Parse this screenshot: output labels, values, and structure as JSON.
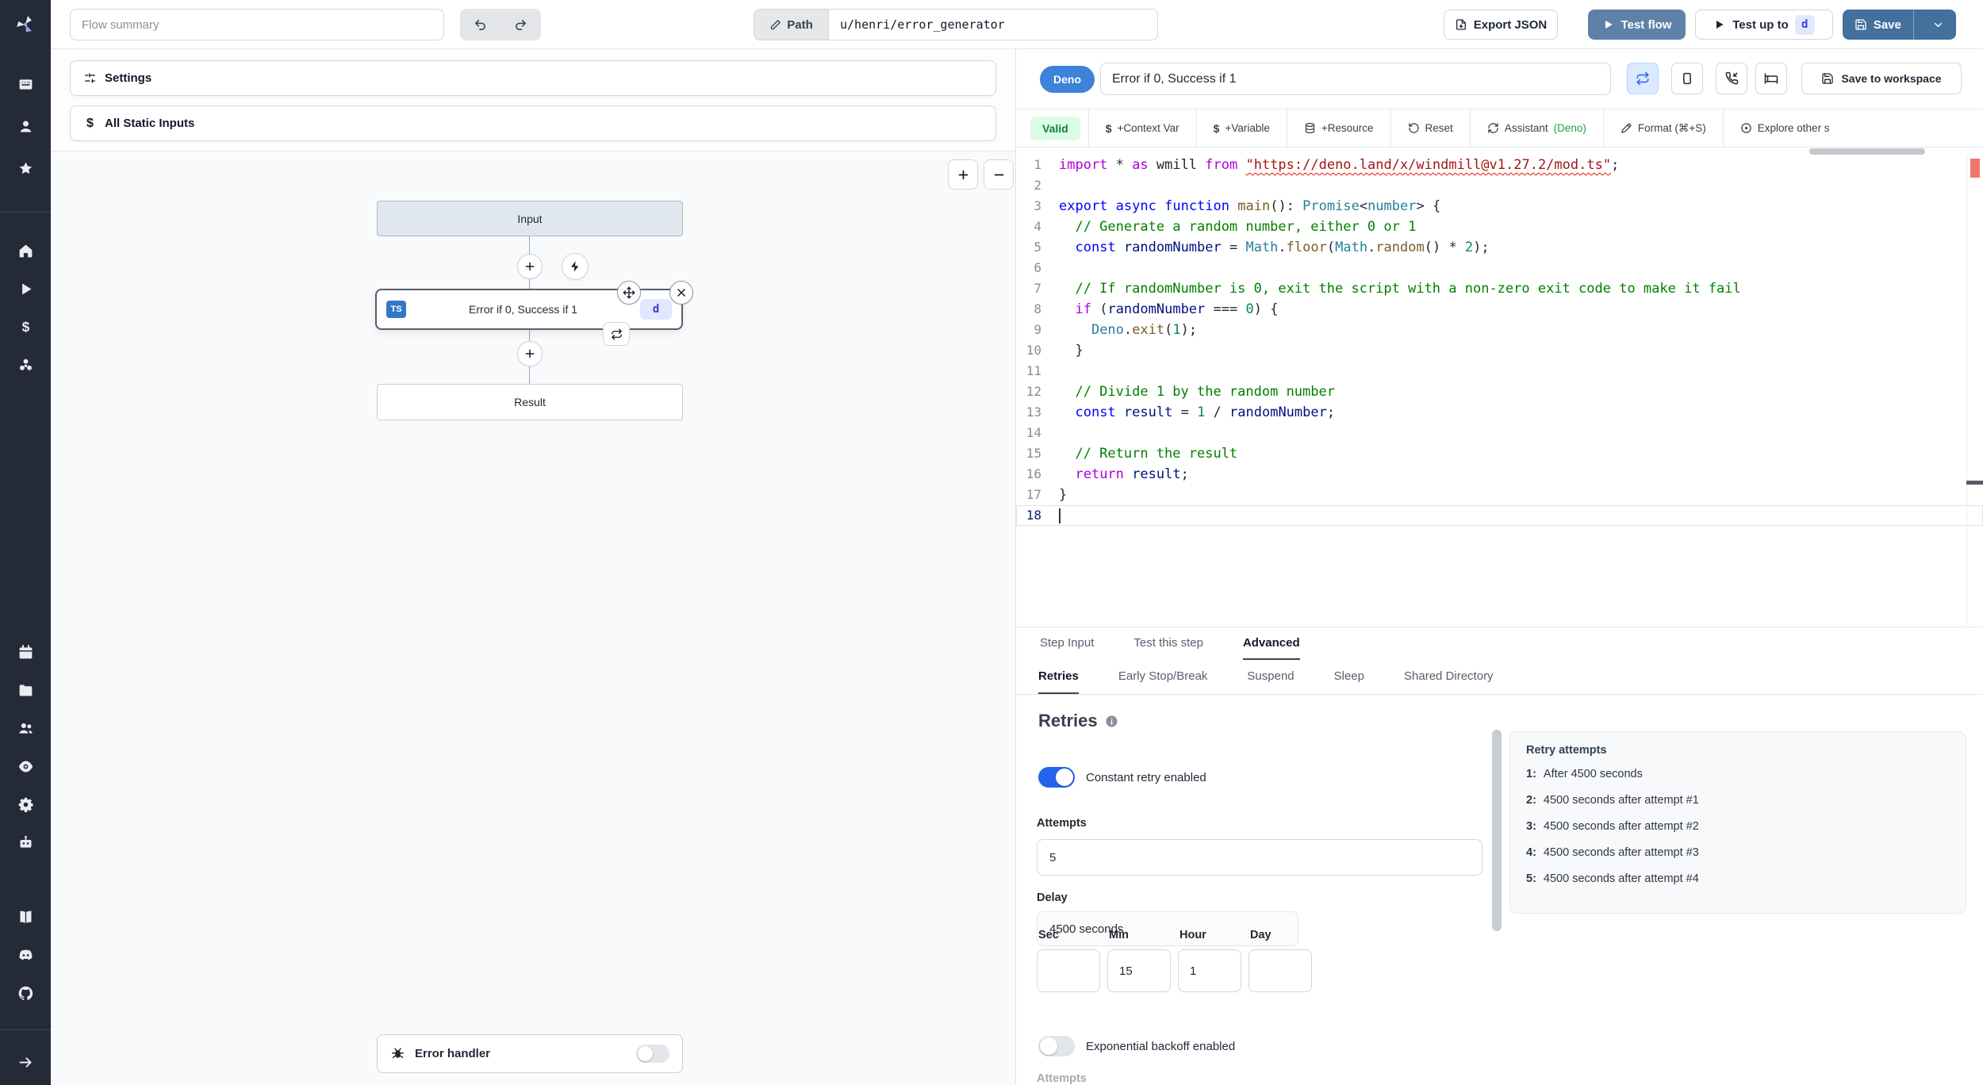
{
  "topbar": {
    "flow_summary_placeholder": "Flow summary",
    "path_label": "Path",
    "path_value": "u/henri/error_generator",
    "export_json_label": "Export JSON",
    "test_flow_label": "Test flow",
    "test_up_to_label": "Test up to",
    "test_up_to_key": "d",
    "save_label": "Save"
  },
  "sidebar": {
    "groups": [
      [
        "app-window",
        "user",
        "star"
      ],
      [
        "home",
        "play",
        "dollar",
        "resources"
      ],
      [
        "calendar",
        "folder",
        "users",
        "eye",
        "gear",
        "robot"
      ],
      [
        "book",
        "discord",
        "github"
      ],
      [
        "arrow-right"
      ]
    ]
  },
  "canvas": {
    "settings_label": "Settings",
    "all_static_inputs_label": "All Static Inputs",
    "input_node_label": "Input",
    "step_node": {
      "lang": "TS",
      "title": "Error if 0, Success if 1",
      "id_badge": "d"
    },
    "result_node_label": "Result",
    "error_handler_label": "Error handler"
  },
  "panel": {
    "header": {
      "lang_badge": "Deno",
      "step_title": "Error if 0, Success if 1",
      "save_to_workspace_label": "Save to workspace"
    },
    "toolbar": {
      "valid_label": "Valid",
      "context_var": "+Context Var",
      "variable": "+Variable",
      "resource": "+Resource",
      "reset": "Reset",
      "assistant": "Assistant",
      "assistant_lang": "(Deno)",
      "format": "Format (⌘+S)",
      "explore": "Explore other s"
    },
    "tabs": {
      "step_input": "Step Input",
      "test_this_step": "Test this step",
      "advanced": "Advanced"
    },
    "subtabs": {
      "retries": "Retries",
      "early_stop": "Early Stop/Break",
      "suspend": "Suspend",
      "sleep": "Sleep",
      "shared_directory": "Shared Directory"
    },
    "editor": {
      "lines": [
        [
          [
            "kc",
            "import"
          ],
          [
            "p",
            " * "
          ],
          [
            "kc",
            "as"
          ],
          [
            "p",
            " wmill "
          ],
          [
            "kc",
            "from"
          ],
          [
            "p",
            " "
          ],
          [
            "su",
            "\"https://deno.land/x/windmill@v1.27.2/mod.ts\""
          ],
          [
            "p",
            ";"
          ]
        ],
        [],
        [
          [
            "kb",
            "export"
          ],
          [
            "p",
            " "
          ],
          [
            "kb",
            "async"
          ],
          [
            "p",
            " "
          ],
          [
            "kb",
            "function"
          ],
          [
            "p",
            " "
          ],
          [
            "fn",
            "main"
          ],
          [
            "p",
            "(): "
          ],
          [
            "ty",
            "Promise"
          ],
          [
            "p",
            "<"
          ],
          [
            "ty",
            "number"
          ],
          [
            "p",
            "> {"
          ]
        ],
        [
          [
            "cm",
            "  // Generate a random number, either 0 or 1"
          ]
        ],
        [
          [
            "p",
            "  "
          ],
          [
            "kb",
            "const"
          ],
          [
            "p",
            " "
          ],
          [
            "id",
            "randomNumber"
          ],
          [
            "p",
            " = "
          ],
          [
            "ty",
            "Math"
          ],
          [
            "p",
            "."
          ],
          [
            "fn",
            "floor"
          ],
          [
            "p",
            "("
          ],
          [
            "ty",
            "Math"
          ],
          [
            "p",
            "."
          ],
          [
            "fn",
            "random"
          ],
          [
            "p",
            "() * "
          ],
          [
            "nu",
            "2"
          ],
          [
            "p",
            ");"
          ]
        ],
        [],
        [
          [
            "cm",
            "  // If randomNumber is 0, exit the script with a non-zero exit code to make it fail"
          ]
        ],
        [
          [
            "p",
            "  "
          ],
          [
            "kc",
            "if"
          ],
          [
            "p",
            " ("
          ],
          [
            "id",
            "randomNumber"
          ],
          [
            "p",
            " === "
          ],
          [
            "nu",
            "0"
          ],
          [
            "p",
            ") {"
          ]
        ],
        [
          [
            "p",
            "    "
          ],
          [
            "ty",
            "Deno"
          ],
          [
            "p",
            "."
          ],
          [
            "fn",
            "exit"
          ],
          [
            "p",
            "("
          ],
          [
            "nu",
            "1"
          ],
          [
            "p",
            ");"
          ]
        ],
        [
          [
            "p",
            "  }"
          ]
        ],
        [],
        [
          [
            "cm",
            "  // Divide 1 by the random number"
          ]
        ],
        [
          [
            "p",
            "  "
          ],
          [
            "kb",
            "const"
          ],
          [
            "p",
            " "
          ],
          [
            "id",
            "result"
          ],
          [
            "p",
            " = "
          ],
          [
            "nu",
            "1"
          ],
          [
            "p",
            " / "
          ],
          [
            "id",
            "randomNumber"
          ],
          [
            "p",
            ";"
          ]
        ],
        [],
        [
          [
            "cm",
            "  // Return the result"
          ]
        ],
        [
          [
            "p",
            "  "
          ],
          [
            "kc",
            "return"
          ],
          [
            "p",
            " "
          ],
          [
            "id",
            "result"
          ],
          [
            "p",
            ";"
          ]
        ],
        [
          [
            "p",
            "}"
          ]
        ],
        []
      ]
    },
    "retries": {
      "heading": "Retries",
      "constant_label": "Constant retry enabled",
      "attempts_label": "Attempts",
      "attempts_value": "5",
      "delay_label": "Delay",
      "delay_value": "4500 seconds",
      "sec_label": "Sec",
      "sec_value": "",
      "min_label": "Min",
      "min_value": "15",
      "hour_label": "Hour",
      "hour_value": "1",
      "day_label": "Day",
      "day_value": "",
      "exponential_label": "Exponential backoff enabled",
      "clipped_label": "Attempts",
      "panel_title": "Retry attempts",
      "attempts_list": [
        {
          "num": "1:",
          "text": "After 4500 seconds"
        },
        {
          "num": "2:",
          "text": "4500 seconds after attempt #1"
        },
        {
          "num": "3:",
          "text": "4500 seconds after attempt #2"
        },
        {
          "num": "4:",
          "text": "4500 seconds after attempt #3"
        },
        {
          "num": "5:",
          "text": "4500 seconds after attempt #4"
        }
      ]
    }
  },
  "colors": {
    "accent_blue": "#2563eb",
    "test_flow_blue": "#5e81a8",
    "save_blue": "#44709d",
    "deno_badge_blue": "#3c83d9",
    "ts_badge_blue": "#3178c6",
    "valid_bg_green": "#dcfce7",
    "valid_text_green": "#15803d",
    "sidebar_bg": "#242a38",
    "error_marker_red": "#f0756d"
  }
}
